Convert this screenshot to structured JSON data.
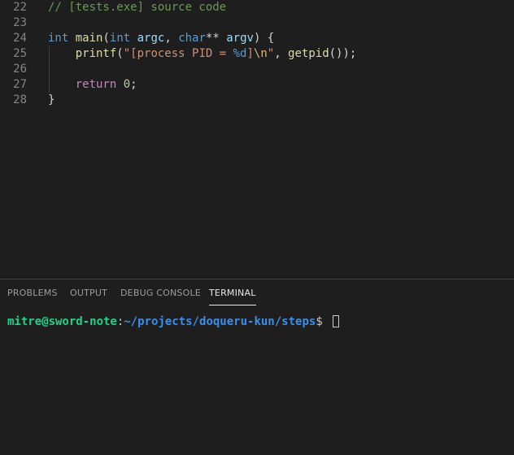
{
  "editor": {
    "lines": [
      {
        "number": "22",
        "tokens": [
          {
            "text": "// [tests.exe] source code",
            "cls": "c-comment"
          }
        ]
      },
      {
        "number": "23",
        "tokens": []
      },
      {
        "number": "24",
        "tokens": [
          {
            "text": "int",
            "cls": "c-kw"
          },
          {
            "text": " ",
            "cls": "c-plain"
          },
          {
            "text": "main",
            "cls": "c-fn"
          },
          {
            "text": "(",
            "cls": "c-plain"
          },
          {
            "text": "int",
            "cls": "c-kw"
          },
          {
            "text": " ",
            "cls": "c-plain"
          },
          {
            "text": "argc",
            "cls": "c-var"
          },
          {
            "text": ", ",
            "cls": "c-plain"
          },
          {
            "text": "char",
            "cls": "c-kw"
          },
          {
            "text": "** ",
            "cls": "c-plain"
          },
          {
            "text": "argv",
            "cls": "c-var"
          },
          {
            "text": ") {",
            "cls": "c-plain"
          }
        ]
      },
      {
        "number": "25",
        "tokens": [
          {
            "text": "    ",
            "cls": "c-plain"
          },
          {
            "text": "printf",
            "cls": "c-fn"
          },
          {
            "text": "(",
            "cls": "c-plain"
          },
          {
            "text": "\"[process PID = ",
            "cls": "c-str"
          },
          {
            "text": "%d",
            "cls": "c-kw"
          },
          {
            "text": "]",
            "cls": "c-str"
          },
          {
            "text": "\\n",
            "cls": "c-esc"
          },
          {
            "text": "\"",
            "cls": "c-str"
          },
          {
            "text": ", ",
            "cls": "c-plain"
          },
          {
            "text": "getpid",
            "cls": "c-fn"
          },
          {
            "text": "());",
            "cls": "c-plain"
          }
        ]
      },
      {
        "number": "26",
        "tokens": []
      },
      {
        "number": "27",
        "tokens": [
          {
            "text": "    ",
            "cls": "c-plain"
          },
          {
            "text": "return",
            "cls": "c-ctrl"
          },
          {
            "text": " ",
            "cls": "c-plain"
          },
          {
            "text": "0",
            "cls": "c-num"
          },
          {
            "text": ";",
            "cls": "c-plain"
          }
        ]
      },
      {
        "number": "28",
        "tokens": [
          {
            "text": "}",
            "cls": "c-plain"
          }
        ]
      }
    ]
  },
  "panel": {
    "tabs": [
      {
        "label": "PROBLEMS",
        "active": false
      },
      {
        "label": "OUTPUT",
        "active": false
      },
      {
        "label": "DEBUG CONSOLE",
        "active": false
      },
      {
        "label": "TERMINAL",
        "active": true
      }
    ]
  },
  "terminal": {
    "user_host": "mitre@sword-note",
    "separator": ":",
    "path": "~/projects/doqueru-kun/steps",
    "prompt_symbol": "$ "
  },
  "colors": {
    "background": "#1e1e1e",
    "comment": "#6a9955",
    "keyword": "#569cd6",
    "function": "#dcdcaa",
    "string": "#ce9178",
    "number": "#b5cea8",
    "terminal_user": "#23d18b",
    "terminal_path": "#3b8eea"
  }
}
